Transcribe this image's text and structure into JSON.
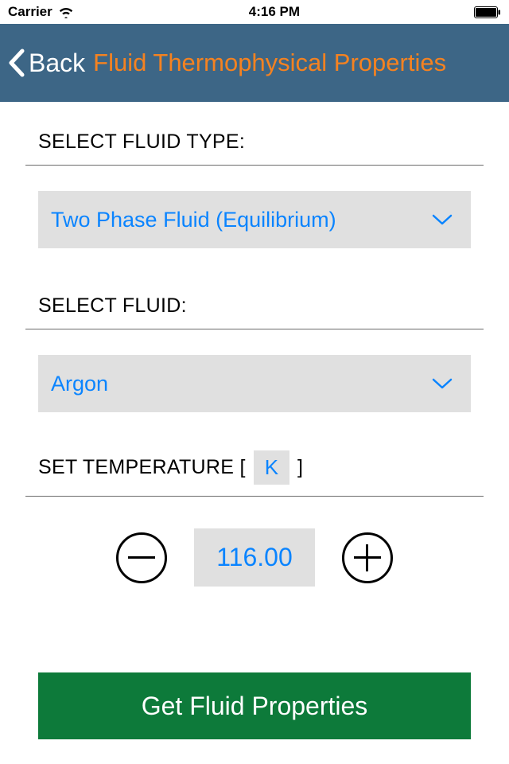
{
  "status": {
    "carrier": "Carrier",
    "time": "4:16 PM"
  },
  "nav": {
    "back_label": "Back",
    "title": "Fluid Thermophysical Properties"
  },
  "fluid_type": {
    "label": "SELECT FLUID TYPE:",
    "selected": "Two Phase Fluid (Equilibrium)"
  },
  "fluid": {
    "label": "SELECT FLUID:",
    "selected": "Argon"
  },
  "temperature": {
    "label_prefix": "SET TEMPERATURE [",
    "unit": "K",
    "label_suffix": "]",
    "value": "116.00"
  },
  "action": {
    "get_properties_label": "Get Fluid Properties"
  }
}
